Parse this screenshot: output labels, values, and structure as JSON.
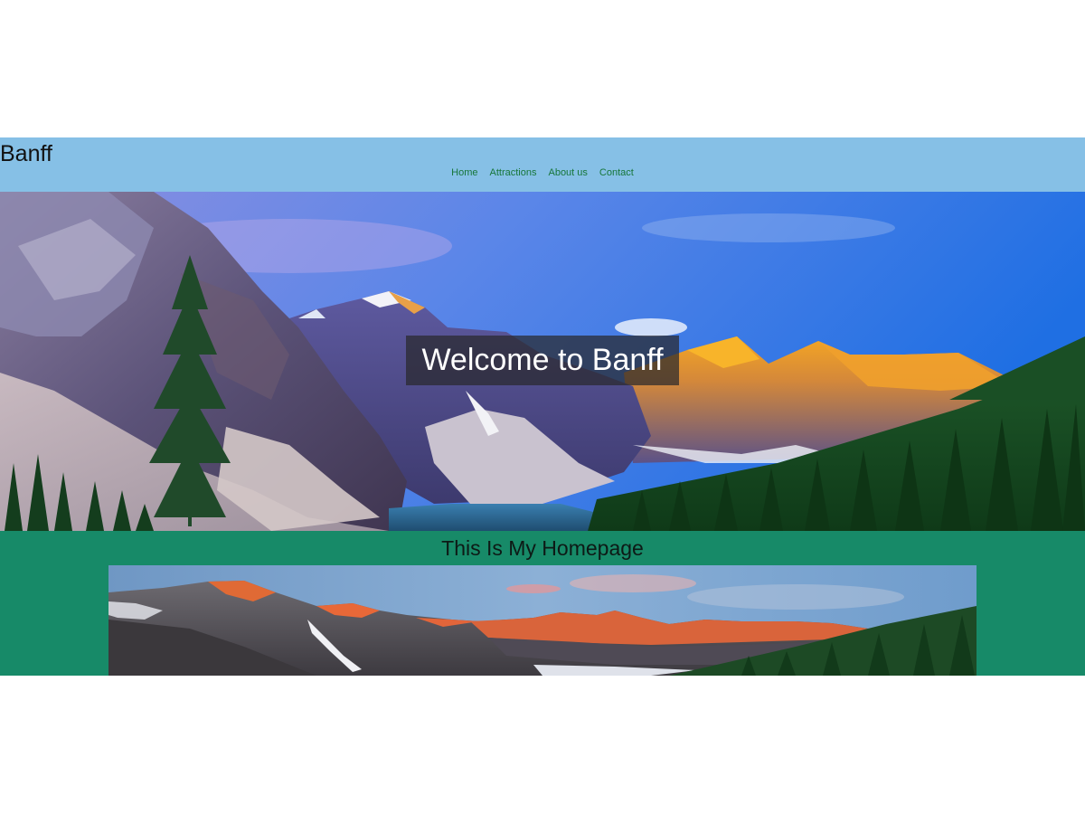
{
  "site": {
    "brand": "Banff",
    "nav": [
      "Home",
      "Attractions",
      "About us",
      "Contact"
    ]
  },
  "hero": {
    "title": "Welcome to Banff",
    "image": "moraine-lake-mountain-photo"
  },
  "content": {
    "heading": "This Is My Homepage",
    "image": "mountain-range-banner-photo"
  },
  "colors": {
    "header_bg": "#86c0e6",
    "nav_link": "#17763a",
    "content_bg": "#178a68",
    "hero_title_bg": "rgba(40,40,45,0.72)"
  }
}
